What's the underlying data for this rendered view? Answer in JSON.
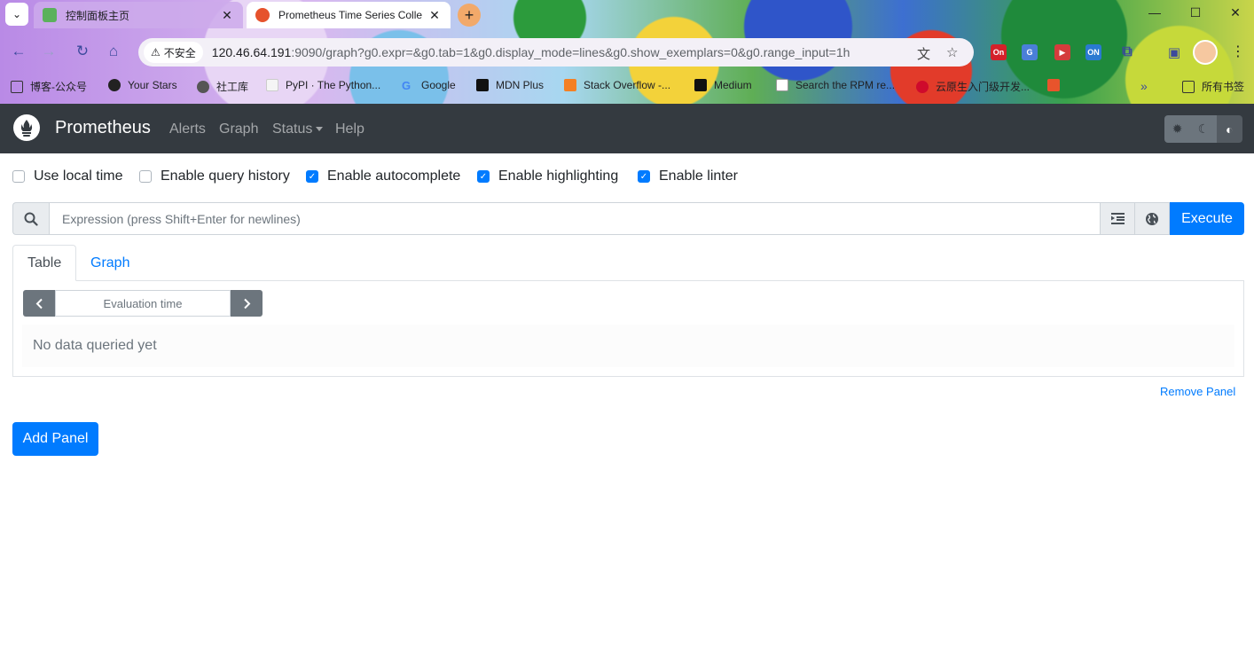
{
  "browser": {
    "tabs": [
      {
        "title": "控制面板主页",
        "active": false
      },
      {
        "title": "Prometheus Time Series Colle",
        "active": true
      }
    ],
    "window_controls": {
      "minimize": "—",
      "maximize": "☐",
      "close": "✕"
    },
    "security_label": "不安全",
    "url_host": "120.46.64.191",
    "url_rest": ":9090/graph?g0.expr=&g0.tab=1&g0.display_mode=lines&g0.show_exemplars=0&g0.range_input=1h",
    "extensions": [
      {
        "label": "On",
        "color": "#d4212a"
      },
      {
        "label": "G",
        "color": "#4a7fd8"
      },
      {
        "label": "▶",
        "color": "#d43c3c"
      },
      {
        "label": "ON",
        "color": "#2a7ad1"
      }
    ],
    "bookmarks": [
      {
        "label": "博客-公众号"
      },
      {
        "label": "Your Stars"
      },
      {
        "label": "社工库"
      },
      {
        "label": "PyPI · The Python..."
      },
      {
        "label": "Google"
      },
      {
        "label": "MDN Plus"
      },
      {
        "label": "Stack Overflow -..."
      },
      {
        "label": "Medium"
      },
      {
        "label": "Search the RPM re..."
      },
      {
        "label": "云原生入门级开发..."
      }
    ],
    "bookmarks_more": "»",
    "all_bookmarks": "所有书签"
  },
  "navbar": {
    "brand": "Prometheus",
    "links": {
      "alerts": "Alerts",
      "graph": "Graph",
      "status": "Status",
      "help": "Help"
    },
    "theme_buttons": [
      "sun-icon",
      "moon-icon",
      "contrast-icon"
    ]
  },
  "options": {
    "use_local_time": {
      "label": "Use local time",
      "checked": false
    },
    "enable_query_history": {
      "label": "Enable query history",
      "checked": false
    },
    "enable_autocomplete": {
      "label": "Enable autocomplete",
      "checked": true
    },
    "enable_highlighting": {
      "label": "Enable highlighting",
      "checked": true
    },
    "enable_linter": {
      "label": "Enable linter",
      "checked": true
    }
  },
  "expression": {
    "placeholder": "Expression (press Shift+Enter for newlines)",
    "execute": "Execute"
  },
  "panel": {
    "tabs": {
      "table": "Table",
      "graph": "Graph"
    },
    "eval_placeholder": "Evaluation time",
    "no_data": "No data queried yet",
    "remove": "Remove Panel"
  },
  "add_panel": "Add Panel",
  "colors": {
    "primary": "#007bff",
    "navbar": "#343a40"
  }
}
